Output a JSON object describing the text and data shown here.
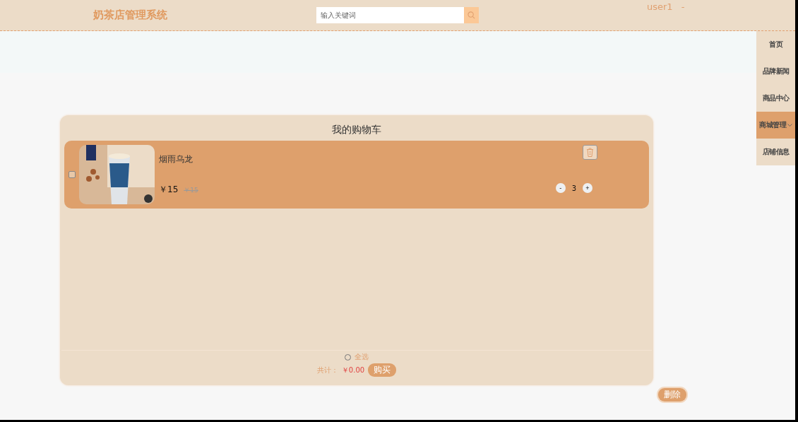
{
  "header": {
    "title": "奶茶店管理系统",
    "search": {
      "placeholder": "输入关键词"
    },
    "user": "user1",
    "user_caret": "-"
  },
  "nav": [
    {
      "label": "首页",
      "selected": false,
      "expandable": false
    },
    {
      "label": "品牌新闻",
      "selected": false,
      "expandable": false
    },
    {
      "label": "商品中心",
      "selected": false,
      "expandable": false
    },
    {
      "label": "商城管理",
      "selected": true,
      "expandable": true
    },
    {
      "label": "店铺信息",
      "selected": false,
      "expandable": false
    }
  ],
  "cart": {
    "title": "我的购物车",
    "items": [
      {
        "name": "烟雨乌龙",
        "price": "￥15",
        "original_price": "￥15",
        "quantity": "3",
        "minus": "-",
        "plus": "+",
        "checked": false
      }
    ],
    "select_all": {
      "label": "全选",
      "checked": false
    },
    "total_label": "共计：",
    "total": "￥0.00",
    "buy": "购买"
  },
  "delete": "删除"
}
